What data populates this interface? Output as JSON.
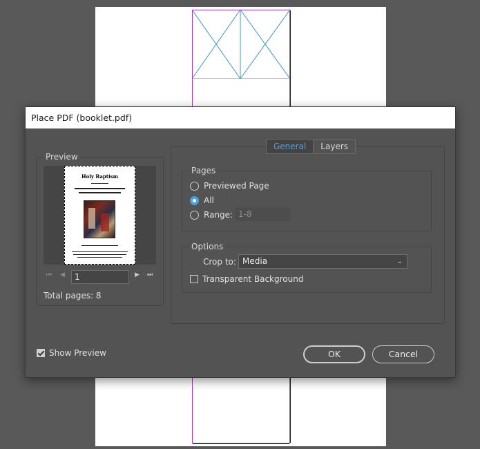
{
  "dialog": {
    "title": "Place PDF (booklet.pdf)",
    "show_preview_label": "Show Preview",
    "show_preview_checked": true,
    "ok_label": "OK",
    "cancel_label": "Cancel"
  },
  "preview": {
    "group_title": "Preview",
    "thumbnail_title": "Holy Baptism",
    "current_page": "1",
    "total_pages_text": "Total pages: 8"
  },
  "tabs": [
    {
      "label": "General",
      "active": true
    },
    {
      "label": "Layers",
      "active": false
    }
  ],
  "pages": {
    "group_title": "Pages",
    "options": [
      {
        "label": "Previewed Page",
        "selected": false
      },
      {
        "label": "All",
        "selected": true
      },
      {
        "label": "Range:",
        "selected": false
      }
    ],
    "range_value": "1-8"
  },
  "options": {
    "group_title": "Options",
    "crop_label": "Crop to:",
    "crop_value": "Media",
    "transparent_label": "Transparent Background",
    "transparent_checked": false
  },
  "colors": {
    "dialog_bg": "#535353",
    "accent": "#49a2e8",
    "frame": "#b43bbf"
  }
}
